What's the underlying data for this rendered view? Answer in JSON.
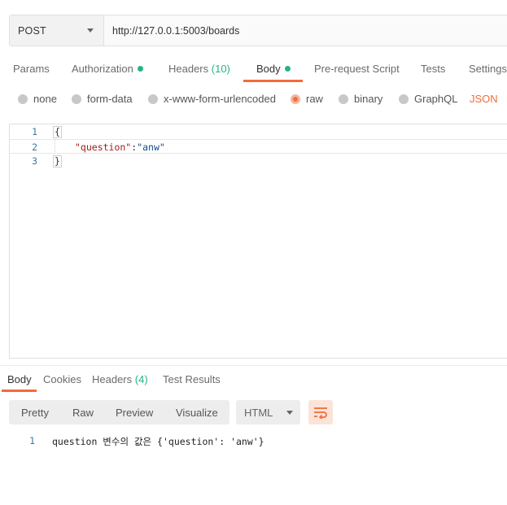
{
  "request": {
    "method": "POST",
    "url": "http://127.0.0.1:5003/boards"
  },
  "request_tabs": {
    "params": "Params",
    "authorization": "Authorization",
    "headers": "Headers",
    "headers_count": "(10)",
    "body": "Body",
    "prerequest": "Pre-request Script",
    "tests": "Tests",
    "settings": "Settings",
    "active": "Body"
  },
  "body_types": {
    "none": "none",
    "form_data": "form-data",
    "urlencoded": "x-www-form-urlencoded",
    "raw": "raw",
    "binary": "binary",
    "graphql": "GraphQL",
    "selected": "raw",
    "format": "JSON"
  },
  "editor": {
    "lines": [
      {
        "num": "1",
        "open_brace": "{"
      },
      {
        "num": "2",
        "key": "\"question\"",
        "colon": ":",
        "value": "\"anw\""
      },
      {
        "num": "3",
        "close_brace": "}"
      }
    ]
  },
  "response_tabs": {
    "body": "Body",
    "cookies": "Cookies",
    "headers": "Headers",
    "headers_count": "(4)",
    "test_results": "Test Results",
    "active": "Body"
  },
  "response_view": {
    "pretty": "Pretty",
    "raw": "Raw",
    "preview": "Preview",
    "visualize": "Visualize",
    "format": "HTML"
  },
  "response_body": {
    "line_num": "1",
    "text": "question 변수의 값은 {'question': 'anw'}"
  },
  "colors": {
    "accent": "#f26b3a",
    "status_green": "#26b47f",
    "json_key": "#a11b1b",
    "json_string": "#0e4c8a"
  },
  "icons": {
    "method_dropdown": "chevron-down-icon",
    "format_dropdown": "chevron-down-icon",
    "wrap": "wrap-lines-icon"
  }
}
